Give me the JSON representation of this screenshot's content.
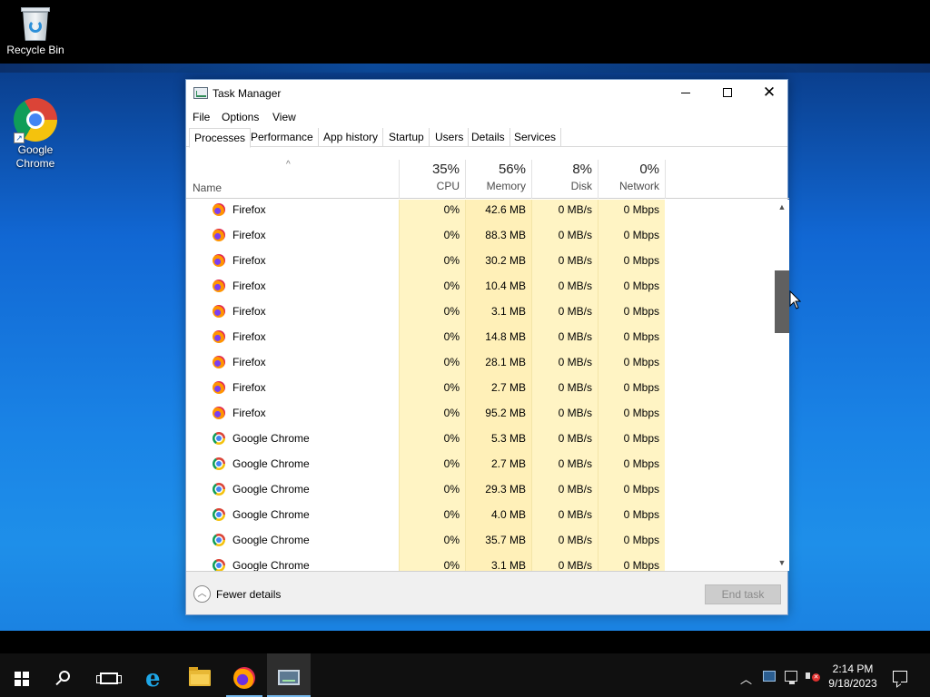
{
  "desktop": {
    "icons": [
      {
        "label": "Recycle Bin",
        "icon": "recycle-bin-icon"
      },
      {
        "label": "Google\nChrome",
        "icon": "chrome-icon"
      }
    ]
  },
  "window": {
    "title": "Task Manager",
    "icon": "task-manager-icon",
    "controls": [
      "minimize-icon",
      "maximize-icon",
      "close-icon"
    ]
  },
  "menu": {
    "file": "File",
    "options": "Options",
    "view": "View"
  },
  "tabs": [
    {
      "label": "Processes",
      "active": true
    },
    {
      "label": "Performance",
      "active": false
    },
    {
      "label": "App history",
      "active": false
    },
    {
      "label": "Startup",
      "active": false
    },
    {
      "label": "Users",
      "active": false
    },
    {
      "label": "Details",
      "active": false
    },
    {
      "label": "Services",
      "active": false
    }
  ],
  "columns": {
    "name": "Name",
    "sort_indicator": "^",
    "cpu": {
      "percent": "35%",
      "label": "CPU"
    },
    "memory": {
      "percent": "56%",
      "label": "Memory"
    },
    "disk": {
      "percent": "8%",
      "label": "Disk"
    },
    "network": {
      "percent": "0%",
      "label": "Network"
    }
  },
  "processes": [
    {
      "name": "Firefox",
      "icon": "firefox-icon",
      "cpu": "0%",
      "memory": "42.6 MB",
      "disk": "0 MB/s",
      "network": "0 Mbps"
    },
    {
      "name": "Firefox",
      "icon": "firefox-icon",
      "cpu": "0%",
      "memory": "88.3 MB",
      "disk": "0 MB/s",
      "network": "0 Mbps"
    },
    {
      "name": "Firefox",
      "icon": "firefox-icon",
      "cpu": "0%",
      "memory": "30.2 MB",
      "disk": "0 MB/s",
      "network": "0 Mbps"
    },
    {
      "name": "Firefox",
      "icon": "firefox-icon",
      "cpu": "0%",
      "memory": "10.4 MB",
      "disk": "0 MB/s",
      "network": "0 Mbps"
    },
    {
      "name": "Firefox",
      "icon": "firefox-icon",
      "cpu": "0%",
      "memory": "3.1 MB",
      "disk": "0 MB/s",
      "network": "0 Mbps"
    },
    {
      "name": "Firefox",
      "icon": "firefox-icon",
      "cpu": "0%",
      "memory": "14.8 MB",
      "disk": "0 MB/s",
      "network": "0 Mbps"
    },
    {
      "name": "Firefox",
      "icon": "firefox-icon",
      "cpu": "0%",
      "memory": "28.1 MB",
      "disk": "0 MB/s",
      "network": "0 Mbps"
    },
    {
      "name": "Firefox",
      "icon": "firefox-icon",
      "cpu": "0%",
      "memory": "2.7 MB",
      "disk": "0 MB/s",
      "network": "0 Mbps"
    },
    {
      "name": "Firefox",
      "icon": "firefox-icon",
      "cpu": "0%",
      "memory": "95.2 MB",
      "disk": "0 MB/s",
      "network": "0 Mbps"
    },
    {
      "name": "Google Chrome",
      "icon": "chrome-icon",
      "cpu": "0%",
      "memory": "5.3 MB",
      "disk": "0 MB/s",
      "network": "0 Mbps"
    },
    {
      "name": "Google Chrome",
      "icon": "chrome-icon",
      "cpu": "0%",
      "memory": "2.7 MB",
      "disk": "0 MB/s",
      "network": "0 Mbps"
    },
    {
      "name": "Google Chrome",
      "icon": "chrome-icon",
      "cpu": "0%",
      "memory": "29.3 MB",
      "disk": "0 MB/s",
      "network": "0 Mbps"
    },
    {
      "name": "Google Chrome",
      "icon": "chrome-icon",
      "cpu": "0%",
      "memory": "4.0 MB",
      "disk": "0 MB/s",
      "network": "0 Mbps"
    },
    {
      "name": "Google Chrome",
      "icon": "chrome-icon",
      "cpu": "0%",
      "memory": "35.7 MB",
      "disk": "0 MB/s",
      "network": "0 Mbps"
    },
    {
      "name": "Google Chrome",
      "icon": "chrome-icon",
      "cpu": "0%",
      "memory": "3.1 MB",
      "disk": "0 MB/s",
      "network": "0 Mbps"
    }
  ],
  "footer": {
    "fewer_details": "Fewer details",
    "end_task": "End task"
  },
  "taskbar": {
    "items": [
      "start-icon",
      "search-icon",
      "task-view-icon",
      "internet-explorer-icon",
      "file-explorer-icon",
      "firefox-icon",
      "task-manager-icon"
    ],
    "time": "2:14 PM",
    "date": "9/18/2023"
  }
}
